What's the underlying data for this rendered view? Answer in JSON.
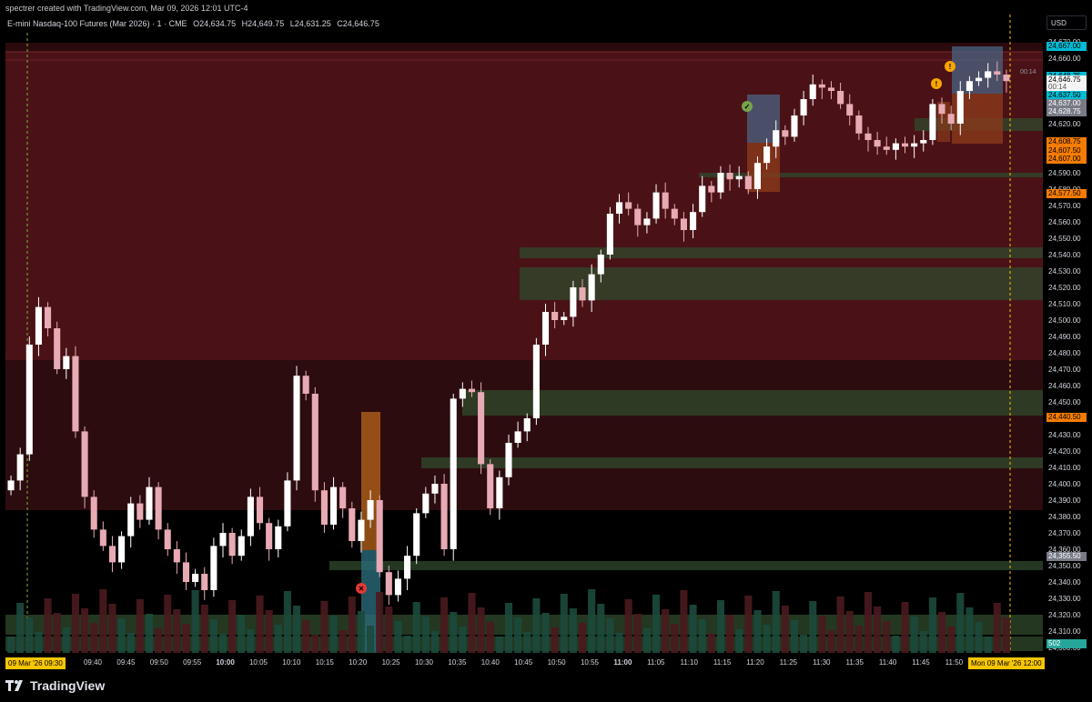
{
  "header": {
    "attribution": "spectrer created with TradingView.com, Mar 09, 2026 12:01 UTC-4"
  },
  "symbol": {
    "name": "E-mini Nasdaq-100 Futures (Mar 2026) · 1 · CME",
    "open": "O24,634.75",
    "high": "H24,649.75",
    "low": "L24,631.25",
    "close": "C24,646.75"
  },
  "currency": "USD",
  "countdown": "00:14",
  "price_axis": {
    "min": 24300,
    "max": 24670,
    "ticks": [
      "24,670.00",
      "24,660.00",
      "24,650.00",
      "24,640.00",
      "24,630.00",
      "24,620.00",
      "24,610.00",
      "24,600.00",
      "24,590.00",
      "24,580.00",
      "24,570.00",
      "24,560.00",
      "24,550.00",
      "24,540.00",
      "24,530.00",
      "24,520.00",
      "24,510.00",
      "24,500.00",
      "24,490.00",
      "24,480.00",
      "24,470.00",
      "24,460.00",
      "24,450.00",
      "24,440.00",
      "24,430.00",
      "24,420.00",
      "24,410.00",
      "24,400.00",
      "24,390.00",
      "24,380.00",
      "24,370.00",
      "24,360.00",
      "24,350.00",
      "24,340.00",
      "24,330.00",
      "24,320.00",
      "24,310.00",
      "24,300.00"
    ],
    "badges": [
      {
        "text": "24,667.00",
        "price": 24667,
        "bg": "#00bcd4",
        "fg": "#000000"
      },
      {
        "text": "24,648.75",
        "price": 24648.75,
        "bg": "#00bcd4",
        "fg": "#000000"
      },
      {
        "text": "24,646.75",
        "price": 24646.75,
        "bg": "#f5f5f5",
        "fg": "#000000"
      },
      {
        "text": "00:14",
        "price": 24642.5,
        "bg": "#f5f5f5",
        "fg": "#555555"
      },
      {
        "text": "24,637.50",
        "price": 24637.5,
        "bg": "#00bcd4",
        "fg": "#000000"
      },
      {
        "text": "24,637.00",
        "price": 24632.5,
        "bg": "#787b86",
        "fg": "#ffffff"
      },
      {
        "text": "24,628.75",
        "price": 24627.5,
        "bg": "#787b86",
        "fg": "#ffffff"
      },
      {
        "text": "24,608.75",
        "price": 24608.75,
        "bg": "#f57c00",
        "fg": "#000000"
      },
      {
        "text": "24,607.50",
        "price": 24603.5,
        "bg": "#f57c00",
        "fg": "#000000"
      },
      {
        "text": "24,607.00",
        "price": 24598.2,
        "bg": "#f57c00",
        "fg": "#000000"
      },
      {
        "text": "24,577.50",
        "price": 24577.5,
        "bg": "#f57c00",
        "fg": "#000000"
      },
      {
        "text": "24,440.50",
        "price": 24440.5,
        "bg": "#f57c00",
        "fg": "#000000"
      },
      {
        "text": "24,355.50",
        "price": 24355.5,
        "bg": "#787b86",
        "fg": "#ffffff"
      },
      {
        "text": "502",
        "price": 24302,
        "bg": "#26a69a",
        "fg": "#ffffff"
      }
    ]
  },
  "time_axis": {
    "start_badge": "09 Mar '26   09:30",
    "end_badge": "Mon 09 Mar '26   12:00",
    "labels": [
      {
        "text": "09:40",
        "bold": false
      },
      {
        "text": "09:45",
        "bold": false
      },
      {
        "text": "09:50",
        "bold": false
      },
      {
        "text": "09:55",
        "bold": false
      },
      {
        "text": "10:00",
        "bold": true
      },
      {
        "text": "10:05",
        "bold": false
      },
      {
        "text": "10:10",
        "bold": false
      },
      {
        "text": "10:15",
        "bold": false
      },
      {
        "text": "10:20",
        "bold": false
      },
      {
        "text": "10:25",
        "bold": false
      },
      {
        "text": "10:30",
        "bold": false
      },
      {
        "text": "10:35",
        "bold": false
      },
      {
        "text": "10:40",
        "bold": false
      },
      {
        "text": "10:45",
        "bold": false
      },
      {
        "text": "10:50",
        "bold": false
      },
      {
        "text": "10:55",
        "bold": false
      },
      {
        "text": "11:00",
        "bold": true
      },
      {
        "text": "11:05",
        "bold": false
      },
      {
        "text": "11:10",
        "bold": false
      },
      {
        "text": "11:15",
        "bold": false
      },
      {
        "text": "11:20",
        "bold": false
      },
      {
        "text": "11:25",
        "bold": false
      },
      {
        "text": "11:30",
        "bold": false
      },
      {
        "text": "11:35",
        "bold": false
      },
      {
        "text": "11:40",
        "bold": false
      },
      {
        "text": "11:45",
        "bold": false
      },
      {
        "text": "11:50",
        "bold": false
      }
    ]
  },
  "chart_data": {
    "type": "candlestick",
    "interval": "1",
    "x_start": "09:30",
    "x_end": "12:00",
    "ylim": [
      24300,
      24670
    ],
    "closes": [
      24402,
      24418,
      24485,
      24508,
      24495,
      24470,
      24478,
      24432,
      24392,
      24372,
      24362,
      24352,
      24368,
      24388,
      24378,
      24398,
      24372,
      24360,
      24352,
      24340,
      24345,
      24335,
      24362,
      24370,
      24356,
      24368,
      24392,
      24376,
      24360,
      24374,
      24402,
      24466,
      24455,
      24396,
      24375,
      24398,
      24385,
      24365,
      24378,
      24390,
      24346,
      24332,
      24342,
      24356,
      24382,
      24394,
      24400,
      24360,
      24452,
      24458,
      24456,
      24412,
      24385,
      24404,
      24425,
      24432,
      24440,
      24485,
      24505,
      24500,
      24502,
      24520,
      24512,
      24528,
      24540,
      24565,
      24572,
      24568,
      24558,
      24562,
      24578,
      24568,
      24562,
      24555,
      24566,
      24582,
      24578,
      24590,
      24586,
      24588,
      24580,
      24596,
      24606,
      24616,
      24612,
      24625,
      24635,
      24644,
      24642,
      24640,
      24632,
      24625,
      24614,
      24610,
      24606,
      24604,
      24608,
      24606,
      24608,
      24610,
      24632,
      24626,
      24620,
      24640,
      24646,
      24648,
      24652,
      24650,
      24646
    ],
    "volume_max": 502
  },
  "markers": [
    {
      "name": "check-icon",
      "symbol": "✓",
      "color": "#76a34c"
    },
    {
      "name": "warning-icon-1",
      "symbol": "!",
      "color": "#f7a600"
    },
    {
      "name": "warning-icon-2",
      "symbol": "!",
      "color": "#f7a600"
    },
    {
      "name": "close-x-icon",
      "symbol": "✕",
      "color": "#e53935"
    }
  ],
  "brand": {
    "logo_text": "TradingView"
  }
}
